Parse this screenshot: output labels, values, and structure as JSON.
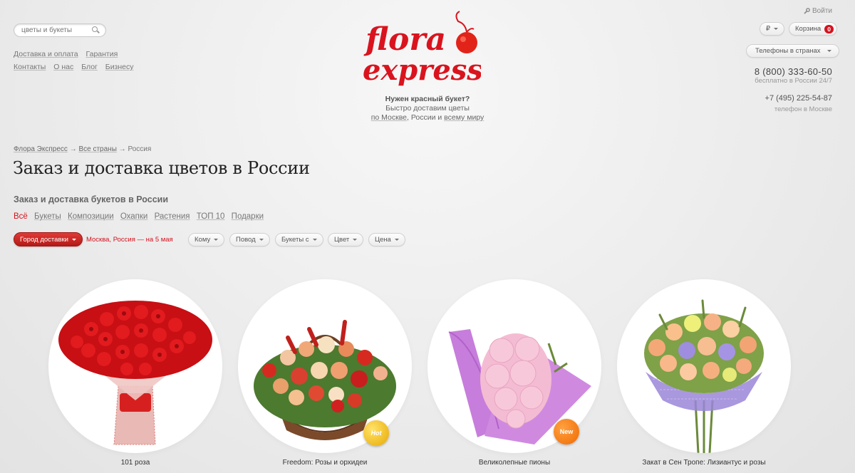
{
  "header": {
    "search": {
      "placeholder": "цветы и букеты",
      "value": ""
    },
    "links_row1": [
      "Доставка и оплата",
      "Гарантия"
    ],
    "links_row2": [
      "Контакты",
      "О нас",
      "Блог",
      "Бизнесу"
    ],
    "logo_line1": "flora",
    "logo_line2": "express",
    "tagline": {
      "bold": "Нужен красный букет?",
      "line2": "Быстро доставим цветы",
      "moscow_link": "по Москве",
      "middle": ", России и ",
      "world_link": "всему миру"
    },
    "login": "Войти",
    "currency": "₽",
    "cart_label": "Корзина",
    "cart_count": "0",
    "phones_dropdown": "Телефоны в странах",
    "phone_main": "8 (800) 333-60-50",
    "phone_main_note": "бесплатно в России 24/7",
    "phone_moscow": "+7 (495) 225-54-87",
    "phone_moscow_note": "телефон в Москве"
  },
  "breadcrumbs": {
    "items": [
      "Флора Экспресс",
      "Все страны"
    ],
    "separator": "→",
    "current": "Россия"
  },
  "page_title": "Заказ и доставка цветов в России",
  "subtitle": "Заказ и доставка букетов в России",
  "categories": [
    "Всё",
    "Букеты",
    "Композиции",
    "Охапки",
    "Растения",
    "ТОП 10",
    "Подарки"
  ],
  "filters": {
    "city_button": "Город доставки",
    "city_text": "Москва, Россия — на 5 мая",
    "dropdowns": [
      "Кому",
      "Повод",
      "Букеты с",
      "Цвет",
      "Цена"
    ]
  },
  "products": [
    {
      "name": "101 роза",
      "icon": "red-roses-bouquet",
      "sticker": ""
    },
    {
      "name": "Freedom: Розы и орхидеи",
      "icon": "flower-basket",
      "sticker": "Hot"
    },
    {
      "name": "Великолепные пионы",
      "icon": "peony-bouquet",
      "sticker": "New"
    },
    {
      "name": "Закат в Сен Тропе: Лизиантус и розы",
      "icon": "lisianthus-roses-bouquet",
      "sticker": ""
    }
  ],
  "colors": {
    "brand_red": "#d4121e",
    "sticker_hot": "#e8a800",
    "sticker_new": "#f06a00"
  }
}
